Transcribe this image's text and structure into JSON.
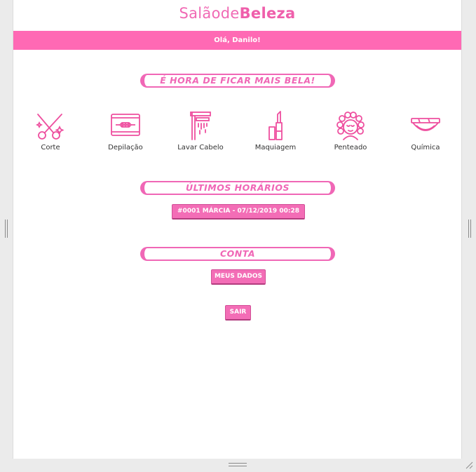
{
  "brand": {
    "part1": "Salãode",
    "part2": "Beleza"
  },
  "greeting": "Olá, Danilo!",
  "sections": {
    "hero": "É HORA DE FICAR MAIS BELA!",
    "recent": "ÚLTIMOS HORÁRIOS",
    "account": "CONTA"
  },
  "services": [
    {
      "label": "Corte",
      "icon": "scissors-icon"
    },
    {
      "label": "Depilação",
      "icon": "razor-blade-icon"
    },
    {
      "label": "Lavar Cabelo",
      "icon": "shower-icon"
    },
    {
      "label": "Maquiagem",
      "icon": "lipstick-icon"
    },
    {
      "label": "Penteado",
      "icon": "hair-curlers-icon"
    },
    {
      "label": "Química",
      "icon": "bowl-icon"
    }
  ],
  "appointments": [
    {
      "label": "#0001 MÁRCIA - 07/12/2019 00:28"
    }
  ],
  "buttons": {
    "my_data": "MEUS DADOS",
    "logout": "SAIR"
  },
  "colors": {
    "accent": "#ff69b4",
    "accent_dark": "#f067b6",
    "background": "#ebebeb"
  }
}
